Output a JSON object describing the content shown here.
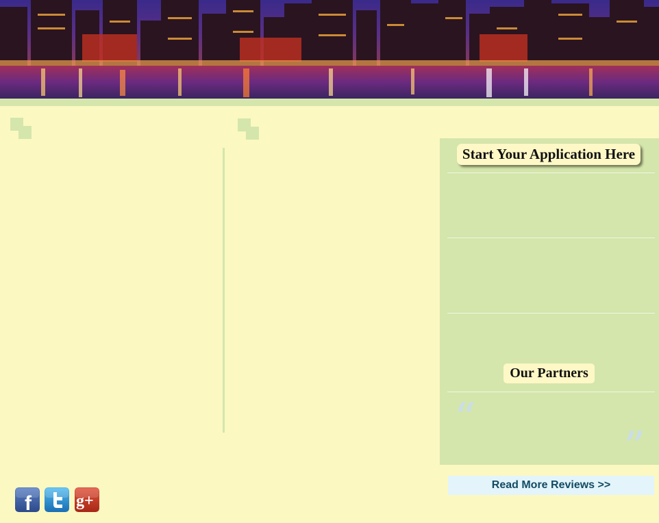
{
  "sidebar": {
    "application_button": "Start Your Application Here",
    "partners_heading": "Our Partners"
  },
  "reviews_link": "Read More Reviews >>",
  "social": {
    "facebook_glyph": "f",
    "google_glyph": "g+"
  },
  "colors": {
    "page_background": "#fbf8c2",
    "panel_green": "#d4e6ab",
    "button_cream": "#fdf8c6",
    "reviews_bg": "#e3f4fb",
    "reviews_text": "#134a63"
  },
  "icons": [
    "city-skyline-banner",
    "corner-squares-icon",
    "open-quote-icon",
    "close-quote-icon",
    "facebook-icon",
    "twitter-icon",
    "google-plus-icon"
  ]
}
